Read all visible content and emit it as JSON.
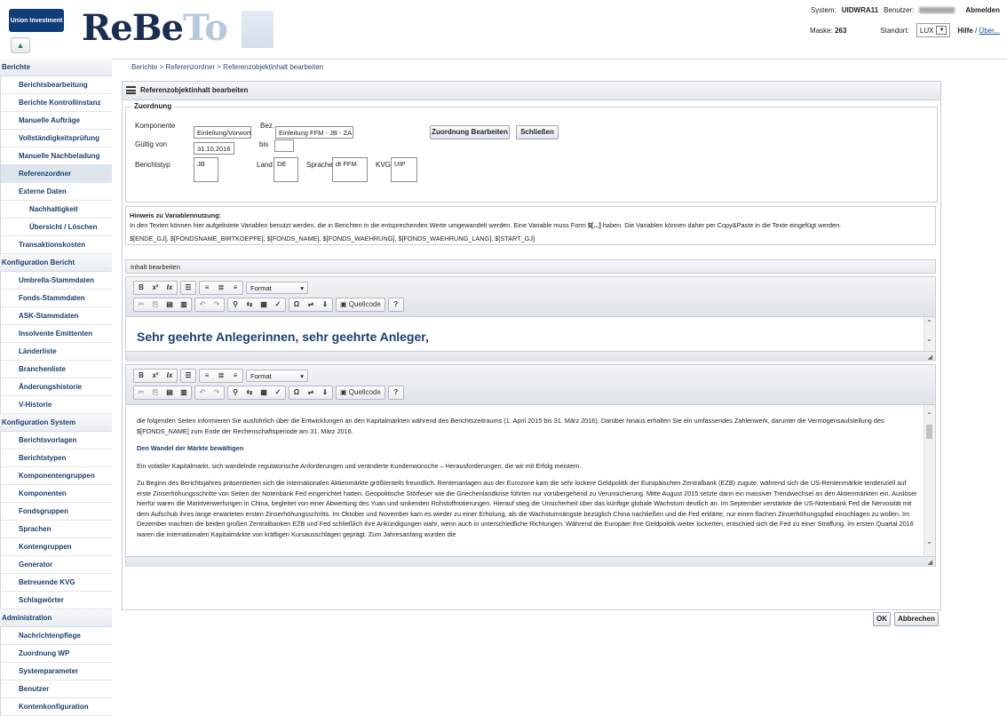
{
  "header": {
    "logo_text": "Union Investment",
    "app_name_main": "ReBe",
    "app_name_faded": "To",
    "system_label": "System:",
    "system_value": "UIDWRA11",
    "user_label": "Benutzer:",
    "logout": "Abmelden",
    "mask_label": "Maske:",
    "mask_value": "263",
    "location_label": "Standort:",
    "location_value": "LUX",
    "help": "Hilfe",
    "about": "Über..."
  },
  "sidebar": {
    "groups": [
      {
        "label": "Berichte",
        "items": [
          {
            "label": "Berichtsbearbeitung"
          },
          {
            "label": "Berichte Kontrollinstanz"
          },
          {
            "label": "Manuelle Aufträge"
          },
          {
            "label": "Vollständigkeitsprüfung"
          },
          {
            "label": "Manuelle Nachbeladung"
          },
          {
            "label": "Referenzordner",
            "active": true
          },
          {
            "label": "Externe Daten"
          },
          {
            "label": "Nachhaltigkeit",
            "sub": true
          },
          {
            "label": "Übersicht / Löschen",
            "sub": true
          },
          {
            "label": "Transaktionskosten"
          }
        ]
      },
      {
        "label": "Konfiguration Bericht",
        "items": [
          {
            "label": "Umbrella-Stammdaten"
          },
          {
            "label": "Fonds-Stammdaten"
          },
          {
            "label": "ASK-Stammdaten"
          },
          {
            "label": "Insolvente Emittenten"
          },
          {
            "label": "Länderliste"
          },
          {
            "label": "Branchenliste"
          },
          {
            "label": "Änderungshistorie"
          },
          {
            "label": "V-Historie"
          }
        ]
      },
      {
        "label": "Konfiguration System",
        "items": [
          {
            "label": "Berichtsvorlagen"
          },
          {
            "label": "Berichtstypen"
          },
          {
            "label": "Komponentengruppen"
          },
          {
            "label": "Komponenten"
          },
          {
            "label": "Fondsgruppen"
          },
          {
            "label": "Sprachen"
          },
          {
            "label": "Kontengruppen"
          },
          {
            "label": "Generator"
          },
          {
            "label": "Betreuende KVG"
          },
          {
            "label": "Schlagwörter"
          }
        ]
      },
      {
        "label": "Administration",
        "items": [
          {
            "label": "Nachrichtenpflege"
          },
          {
            "label": "Zuordnung WP"
          },
          {
            "label": "Systemparameter"
          },
          {
            "label": "Benutzer"
          },
          {
            "label": "Kontenkonfiguration"
          }
        ]
      }
    ]
  },
  "breadcrumb": {
    "text": "Berichte  >  Referenzordner  >  Referenzobjektinhalt bearbeiten"
  },
  "panel": {
    "title": "Referenzobjektinhalt bearbeiten"
  },
  "zuordnung": {
    "legend": "Zuordnung",
    "komponente_label": "Komponente",
    "komponente_value": "Einleitung/Vorwort",
    "bez_label": "Bez.",
    "bez_value": "Einleitung FFM - JB - ZA",
    "gueltig_label": "Gültig von",
    "gueltig_value": "31.10.2016",
    "bis_label": "bis",
    "bis_value": "",
    "berichtstyp_label": "Berichtstyp",
    "berichtstyp_value": "JB",
    "land_label": "Land",
    "land_value": "DE",
    "sprache_label": "Sprache",
    "sprache_value": "dt FFM",
    "kvg_label": "KVG",
    "kvg_value": "UIP",
    "edit_button": "Zuordnung Bearbeiten",
    "close_button": "Schließen"
  },
  "hinweis": {
    "title": "Hinweis zu Variablennutzung:",
    "text_before": "In den Texten können hier aufgelistete Variablen benutzt werden, die in Berichten in die entsprechenden Werte umgewandelt werden. Eine Variable muss Form ",
    "text_bold": "$[...]",
    "text_after": " haben. Die Variablen können daher per Copy&Paste in die Texte eingefügt werden.",
    "variables": "$[ENDE_GJ], $[FONDSNAME_BIRTKOEPFE], $[FONDS_NAME], $[FONDS_WAEHRUNG], $[FONDS_WAEHRUNG_LANG], $[START_GJ]"
  },
  "inhalt": {
    "title": "Inhalt bearbeiten"
  },
  "toolbar": {
    "bold": "B",
    "superscript": "x²",
    "remove_format": "Ix",
    "format_label": "Format",
    "format_arrow": "▾",
    "source_label": "Quellcode",
    "help": "?"
  },
  "editor1": {
    "greeting": "Sehr geehrte Anlegerinnen, sehr geehrte Anleger,"
  },
  "editor2": {
    "para1": "die folgenden Seiten informieren Sie ausführlich über die Entwicklungen an den Kapitalmärkten während des Berichtszeitraums (1. April 2015 bis 31. März 2016). Darüber hinaus erhalten Sie ein umfassendes Zahlenwerk, darunter die Vermögensaufstellung des $[FONDS_NAME] zum Ende der Rechenschaftsperiode am 31. März 2016.",
    "heading": "Den Wandel der Märkte bewältigen",
    "para2": "Ein volatiler Kapitalmarkt, sich wandelnde regulatorische Anforderungen und veränderte Kundenwünsche  – Herausforderungen, die wir mit Erfolg meistern.",
    "para3": "Zu Beginn des Berichtsjahres präsentierten sich die internationalen Aktienmärkte größtenteils freundlich. Rentenanlagen aus der Eurozone kam die sehr lockere Geldpolitik der Europäischen Zentralbank (EZB) zugute, während sich die US-Rentenmärkte tendenziell auf erste Zinserhöhungsschritte von Seiten der Notenbank Fed eingerichtet hatten. Geopolitische Störfeuer wie die Griechenlandkrise führten nur vorübergehend zu Verunsicherung. Mitte August 2015 setzte dann ein massiver Trendwechsel an den Aktienmärkten ein. Auslöser hierfür waren die Marktverwerfungen in China, begleitet von einer Abwertung des Yuan und sinkenden Rohstoffnotierungen. Hierauf stieg die Unsicherheit über das künftige globale Wachstum deutlich an. Im September verstärkte die US-Notenbank Fed die Nervosität mit dem Aufschub ihres lange erwarteten ersten Zinserhöhungsschritts. Im Oktober und November kam es wieder zu einer Erholung, als die Wachstumsängste bezüglich China nachließen und die Fed erklärte, nur einen flachen Zinserhöhungspfad einschlagen zu wollen. Im Dezember machten die beiden großen Zentralbanken EZB und Fed schließlich ihre Ankündigungen wahr, wenn auch in unterschiedliche Richtungen. Während die Europäer ihre Geldpolitik weiter lockerten, entschied sich die Fed zu einer Straffung. Im ersten Quartal 2016 waren die internationalen Kapitalmärkte von kräftigen Kursausschlägen geprägt. Zum Jahresanfang wurden die"
  },
  "footer": {
    "ok": "OK",
    "cancel": "Abbrechen"
  }
}
